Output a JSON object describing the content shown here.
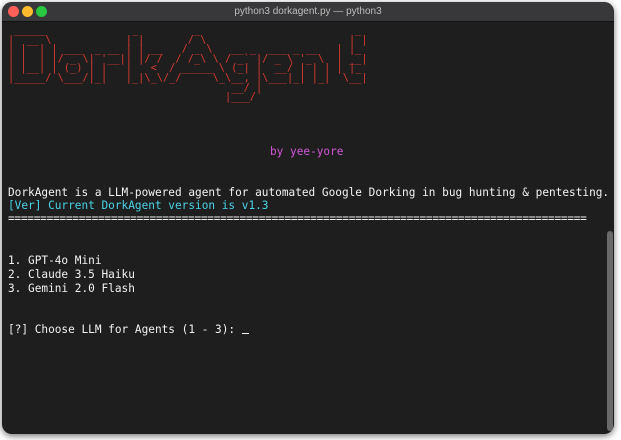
{
  "window": {
    "title": "python3 dorkagent.py — python3"
  },
  "banner": {
    "lines": [
      " _____              _         _                         _",
      "|  __ \\            | |       / \\                       | |",
      "| |  | | ___  _ __ | | __   / _ \\   __ _  ___ _ __   | |_",
      "| |  | |/ _ \\| '__|| |/ /  / /_\\ \\ / _` |/ _ \\ '_ \\  | __|",
      "| |__| | (_) | |   |   <  / _____ \\ (_| |  __/ | | | | |_",
      "|_____/ \\___/|_|   |_|\\_\\/_/     \\_\\__, |\\___|_| |_|  \\__|",
      "                                    __/ |",
      "                                   |___/"
    ],
    "byline": "by yee-yore"
  },
  "terminal": {
    "description": "DorkAgent is a LLM-powered agent for automated Google Dorking in bug hunting & pentesting.",
    "version_line": "[Ver] Current DorkAgent version is v1.3",
    "separator": "==========================================================================================",
    "options": [
      "1. GPT-4o Mini",
      "2. Claude 3.5 Haiku",
      "3. Gemini 2.0 Flash"
    ],
    "prompt": "[?] Choose LLM for Agents (1 - 3): "
  },
  "colors": {
    "background": "#1e1e1e",
    "banner": "#d63a32",
    "byline": "#d257d8",
    "version": "#4ad3e6",
    "text": "#f2f2f2"
  }
}
